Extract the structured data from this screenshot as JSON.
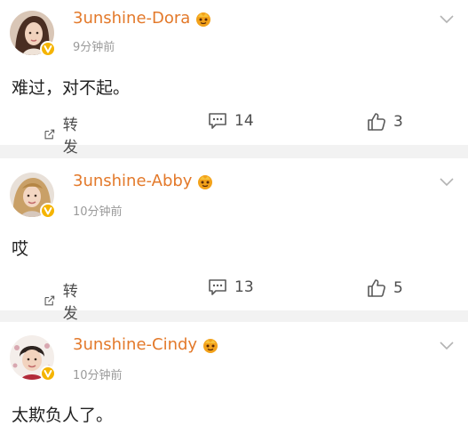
{
  "posts": [
    {
      "username": "3unshine-Dora",
      "time": "9分钟前",
      "text": "难过，对不起。",
      "repost_label": "转发",
      "comments": "14",
      "likes": "3"
    },
    {
      "username": "3unshine-Abby",
      "time": "10分钟前",
      "text": "哎",
      "repost_label": "转发",
      "comments": "13",
      "likes": "5"
    },
    {
      "username": "3unshine-Cindy",
      "time": "10分钟前",
      "text": "太欺负人了。"
    }
  ],
  "icons": {
    "verified": "verified-badge-icon",
    "member": "crown-badge-icon",
    "menu": "chevron-down-icon",
    "repost": "repost-icon",
    "comment": "comment-icon",
    "like": "thumbs-up-icon"
  },
  "colors": {
    "username": "#e3792a",
    "verified": "#f5b400",
    "text": "#222222",
    "muted": "#9a9a9a",
    "background": "#f2f2f2"
  }
}
